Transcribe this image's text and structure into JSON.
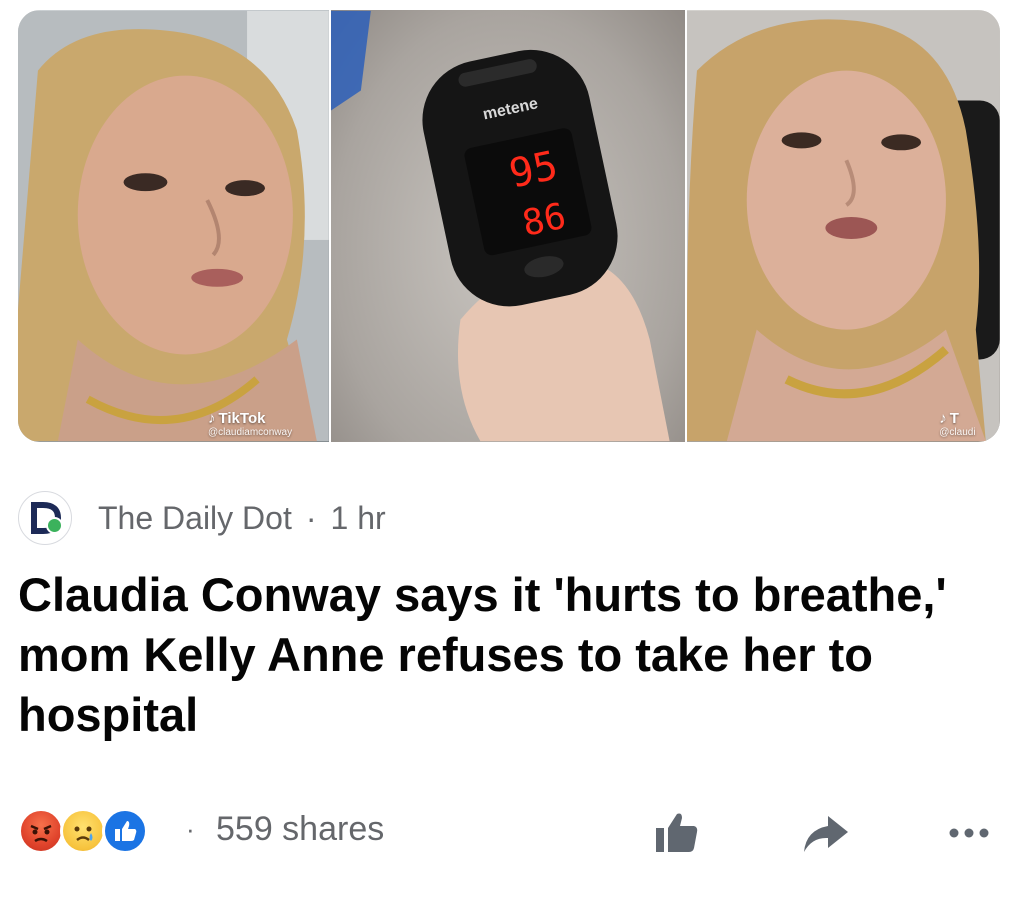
{
  "hero": {
    "watermark_brand": "TikTok",
    "watermark_handle_left": "@claudiamconway",
    "watermark_brand_right": "T",
    "watermark_handle_right": "@claudi",
    "oximeter_brand": "metene",
    "oximeter_reading_top": "95",
    "oximeter_reading_bottom": "86"
  },
  "post": {
    "source": "The Daily Dot",
    "separator": "·",
    "time": "1 hr",
    "headline": "Claudia Conway says it 'hurts to breathe,' mom Kelly Anne refuses to take her to hospital"
  },
  "footer": {
    "reactions": [
      "angry-reaction-icon",
      "sad-reaction-icon",
      "like-reaction-icon"
    ],
    "separator": "·",
    "shares": "559 shares",
    "actions": [
      "like-icon",
      "share-arrow-icon",
      "more-icon"
    ]
  },
  "colors": {
    "secondary_text": "#65676b",
    "headline_text": "#050505",
    "like_blue": "#1b74e4",
    "logo_green": "#3bb25c"
  }
}
